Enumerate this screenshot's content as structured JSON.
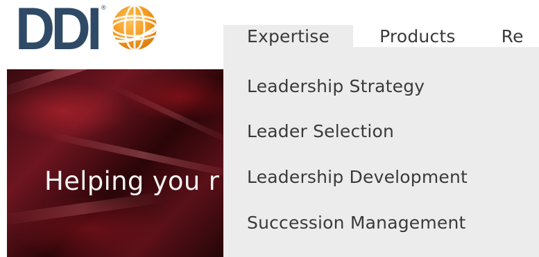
{
  "logo": {
    "text": "DDI",
    "registered": "®",
    "brand_blue": "#2f4a66",
    "globe_orange": "#f39a1e",
    "icon": "globe-icon"
  },
  "nav": {
    "items": [
      {
        "label": "Expertise",
        "active": true
      },
      {
        "label": "Products",
        "active": false
      },
      {
        "label": "Re",
        "active": false
      }
    ]
  },
  "dropdown": {
    "items": [
      {
        "label": "Leadership Strategy"
      },
      {
        "label": "Leader Selection"
      },
      {
        "label": "Leadership Development"
      },
      {
        "label": "Succession Management"
      }
    ],
    "background": "#ececec"
  },
  "hero": {
    "headline": "Helping you r",
    "text_color": "#f2f2f2",
    "accent": "#6e1520"
  }
}
